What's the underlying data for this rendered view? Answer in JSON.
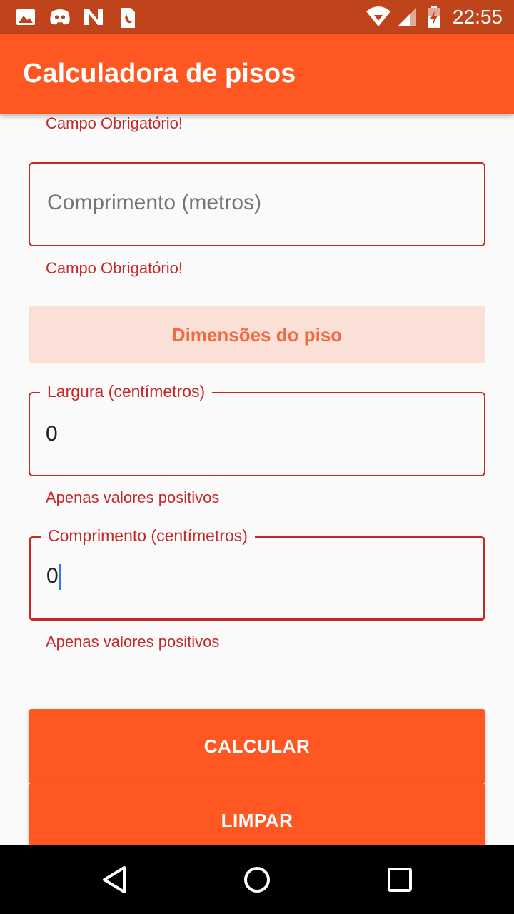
{
  "status_bar": {
    "time": "22:55",
    "left_icons": [
      "image-icon",
      "discord-icon",
      "n-logo-icon",
      "sim-card-icon"
    ],
    "right_icons": [
      "wifi-icon",
      "signal-icon",
      "battery-charging-icon"
    ]
  },
  "app_bar": {
    "title": "Calculadora de pisos"
  },
  "form": {
    "top_error": "Campo Obrigatório!",
    "comprimento_metros": {
      "placeholder": "Comprimento (metros)",
      "error": "Campo Obrigatório!"
    },
    "section_title": "Dimensões do piso",
    "largura_cm": {
      "label": "Largura (centímetros)",
      "value": "0",
      "error": "Apenas valores positivos"
    },
    "comprimento_cm": {
      "label": "Comprimento (centímetros)",
      "value": "0",
      "error": "Apenas valores positivos"
    }
  },
  "buttons": {
    "calcular": "CALCULAR",
    "limpar": "LIMPAR"
  },
  "colors": {
    "primary": "#ff5722",
    "status_bar": "#bf441b",
    "error": "#c62828",
    "section_bg": "#fbe0d8",
    "section_text": "#f26b3f"
  }
}
